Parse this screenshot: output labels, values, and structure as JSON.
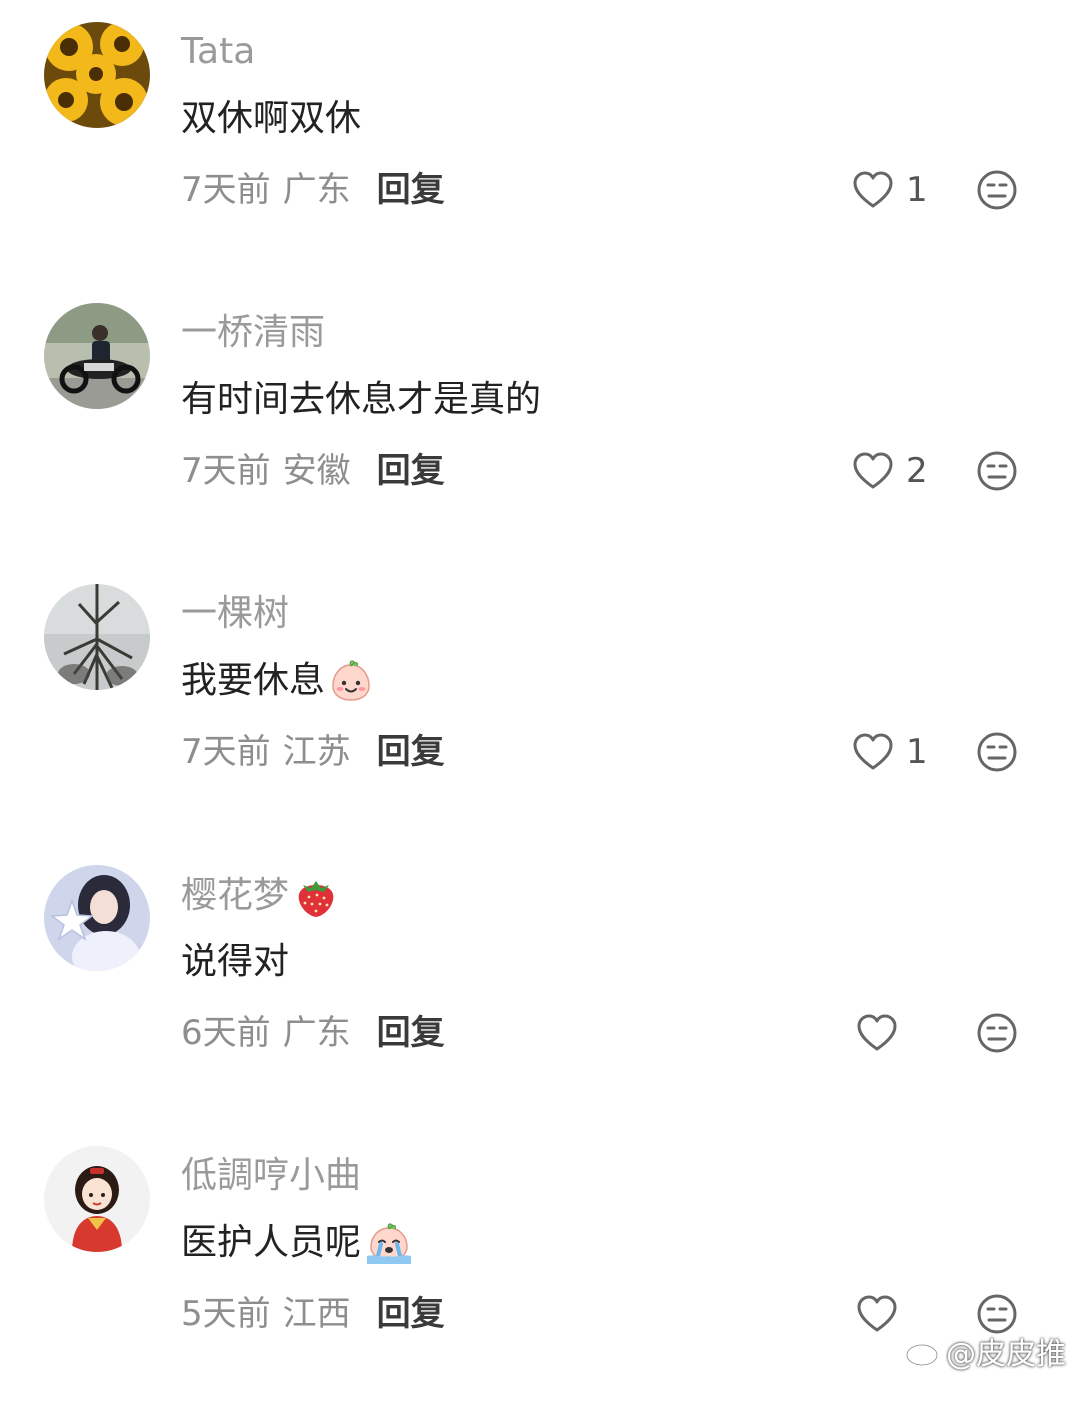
{
  "comments": [
    {
      "username": "Tata",
      "content": "双休啊双休",
      "time": "7天前",
      "region": "广东",
      "reply": "回复",
      "likes": "1",
      "avatar_icon": "sunflower-avatar"
    },
    {
      "username": "一桥清雨",
      "content": "有时间去休息才是真的",
      "time": "7天前",
      "region": "安徽",
      "reply": "回复",
      "likes": "2",
      "avatar_icon": "motorcycle-rider-avatar"
    },
    {
      "username": "一棵树",
      "content": "我要休息",
      "time": "7天前",
      "region": "江苏",
      "reply": "回复",
      "likes": "1",
      "avatar_icon": "tree-reflection-avatar",
      "content_emoji": "smiling-peach-emoji"
    },
    {
      "username": "樱花梦",
      "content": "说得对",
      "time": "6天前",
      "region": "广东",
      "reply": "回复",
      "likes": "",
      "avatar_icon": "girl-with-star-avatar",
      "name_emoji": "strawberry-emoji"
    },
    {
      "username": "低調哼小曲",
      "content": "医护人员呢",
      "time": "5天前",
      "region": "江西",
      "reply": "回复",
      "likes": "",
      "avatar_icon": "cartoon-girl-avatar",
      "content_emoji": "crying-peach-emoji"
    }
  ],
  "watermark": {
    "text": "@皮皮推",
    "icon": "weibo-icon"
  },
  "colors": {
    "username": "#9a9a9a",
    "content": "#222222",
    "meta": "#8e8e8e",
    "reply": "#3a3a3a",
    "icon": "#666666"
  }
}
